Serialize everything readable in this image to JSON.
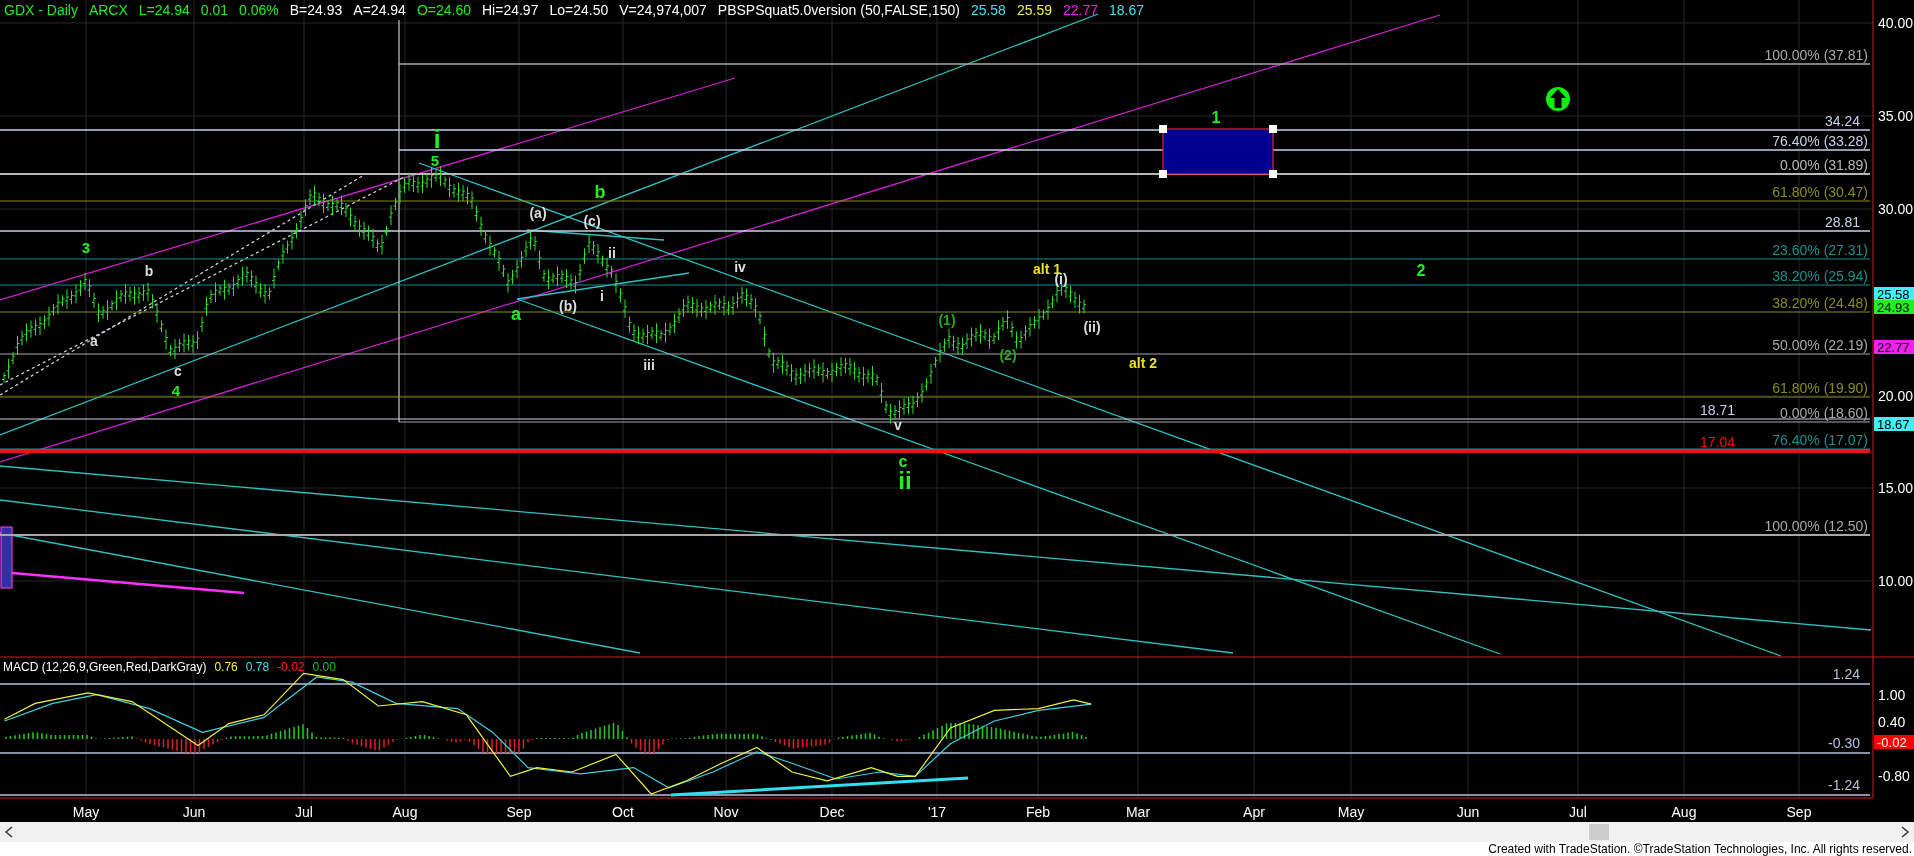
{
  "header": [
    {
      "text": "GDX - Daily",
      "color": "#22ee22"
    },
    {
      "text": "ARCX",
      "color": "#22ee22"
    },
    {
      "text": "L=24.94",
      "color": "#22ee22"
    },
    {
      "text": "0.01",
      "color": "#22ee22"
    },
    {
      "text": "0.06%",
      "color": "#22ee22"
    },
    {
      "text": "B=24.93",
      "color": "#ffffff"
    },
    {
      "text": "A=24.94",
      "color": "#ffffff"
    },
    {
      "text": "O=24.60",
      "color": "#22ee22"
    },
    {
      "text": "Hi=24.97",
      "color": "#ffffff"
    },
    {
      "text": "Lo=24.50",
      "color": "#ffffff"
    },
    {
      "text": "V=24,974,007",
      "color": "#ffffff"
    },
    {
      "text": "PBSPSquat5.0version (50,FALSE,150)",
      "color": "#ffffff"
    },
    {
      "text": "25.58",
      "color": "#40e0f0"
    },
    {
      "text": "25.59",
      "color": "#f0f040"
    },
    {
      "text": "22.77",
      "color": "#f020f0"
    },
    {
      "text": "18.67",
      "color": "#40e0f0"
    }
  ],
  "price_axis": {
    "ticks": [
      "40.00",
      "35.00",
      "30.00",
      "20.00",
      "15.00",
      "10.00"
    ],
    "tags": [
      {
        "text": "25.58",
        "color": "#40f0f8"
      },
      {
        "text": "24.93",
        "color": "#22ee22"
      },
      {
        "text": "22.77",
        "color": "#f020f0"
      },
      {
        "text": "18.67",
        "color": "#40f0f8"
      }
    ]
  },
  "levels": [
    {
      "label": "100.00% (37.81)",
      "color": "#a8a8a8"
    },
    {
      "label": "34.24",
      "color": "#c8d0ea"
    },
    {
      "label": "76.40% (33.28)",
      "color": "#c8d0ea"
    },
    {
      "label": "0.00% (31.89)",
      "color": "#b8b8b8"
    },
    {
      "label": "61.80% (30.47)",
      "color": "#8a8a20"
    },
    {
      "label": "28.81",
      "color": "#c8d0ea"
    },
    {
      "label": "23.60% (27.31)",
      "color": "#1a9090"
    },
    {
      "label": "38.20% (25.94)",
      "color": "#1a9090"
    },
    {
      "label": "38.20% (24.48)",
      "color": "#8a8a20"
    },
    {
      "label": "50.00% (22.19)",
      "color": "#a8a8a8"
    },
    {
      "label": "61.80% (19.90)",
      "color": "#8a8a20"
    },
    {
      "label": "18.71",
      "color": "#c8d0ea"
    },
    {
      "label": "0.00% (18.60)",
      "color": "#a8a8a8"
    },
    {
      "label": "17.04",
      "color": "#ee1111"
    },
    {
      "label": "76.40% (17.07)",
      "color": "#1a9090"
    },
    {
      "label": "100.00% (12.50)",
      "color": "#a8a8a8"
    }
  ],
  "wave_labels": [
    {
      "text": "3",
      "color": "#22ee22"
    },
    {
      "text": "b",
      "color": "#dddddd"
    },
    {
      "text": "a",
      "color": "#dddddd"
    },
    {
      "text": "c",
      "color": "#dddddd"
    },
    {
      "text": "4",
      "color": "#22ee22"
    },
    {
      "text": "i",
      "color": "#22ee22"
    },
    {
      "text": "5",
      "color": "#22ee22"
    },
    {
      "text": "(a)",
      "color": "#dddddd"
    },
    {
      "text": "b",
      "color": "#22ee22"
    },
    {
      "text": "(c)",
      "color": "#dddddd"
    },
    {
      "text": "ii",
      "color": "#dddddd"
    },
    {
      "text": "i",
      "color": "#dddddd"
    },
    {
      "text": "(b)",
      "color": "#dddddd"
    },
    {
      "text": "a",
      "color": "#22ee22"
    },
    {
      "text": "iv",
      "color": "#dddddd"
    },
    {
      "text": "iii",
      "color": "#dddddd"
    },
    {
      "text": "v",
      "color": "#dddddd"
    },
    {
      "text": "c",
      "color": "#22ee22"
    },
    {
      "text": "ii",
      "color": "#22ee22"
    },
    {
      "text": "(1)",
      "color": "#22aa22"
    },
    {
      "text": "(2)",
      "color": "#22aa22"
    },
    {
      "text": "alt 1",
      "color": "#e8e020"
    },
    {
      "text": "(i)",
      "color": "#dddddd"
    },
    {
      "text": "(ii)",
      "color": "#dddddd"
    },
    {
      "text": "alt 2",
      "color": "#e8e020"
    },
    {
      "text": "1",
      "color": "#22ee22"
    },
    {
      "text": "2",
      "color": "#22ee22"
    }
  ],
  "macd": {
    "title": "MACD (12,26,9,Green,Red,DarkGray)",
    "values": [
      {
        "text": "0.76",
        "color": "#f0f040"
      },
      {
        "text": "0.78",
        "color": "#40e0f0"
      },
      {
        "text": "-0.02",
        "color": "#ff2020"
      },
      {
        "text": "0.00",
        "color": "#22bb22"
      }
    ],
    "ticks": [
      "1.00",
      "0.40",
      "-0.80"
    ],
    "tag": {
      "text": "-0.02",
      "color": "#ff0000"
    },
    "levels": [
      "1.24",
      "-0.30",
      "-1.24"
    ]
  },
  "date_axis": [
    "May",
    "Jun",
    "Jul",
    "Aug",
    "Sep",
    "Oct",
    "Nov",
    "Dec",
    "'17",
    "Feb",
    "Mar",
    "Apr",
    "May",
    "Jun",
    "Jul",
    "Aug",
    "Sep"
  ],
  "footer": "Created with TradeStation. ©TradeStation Technologies, Inc. All rights reserved."
}
